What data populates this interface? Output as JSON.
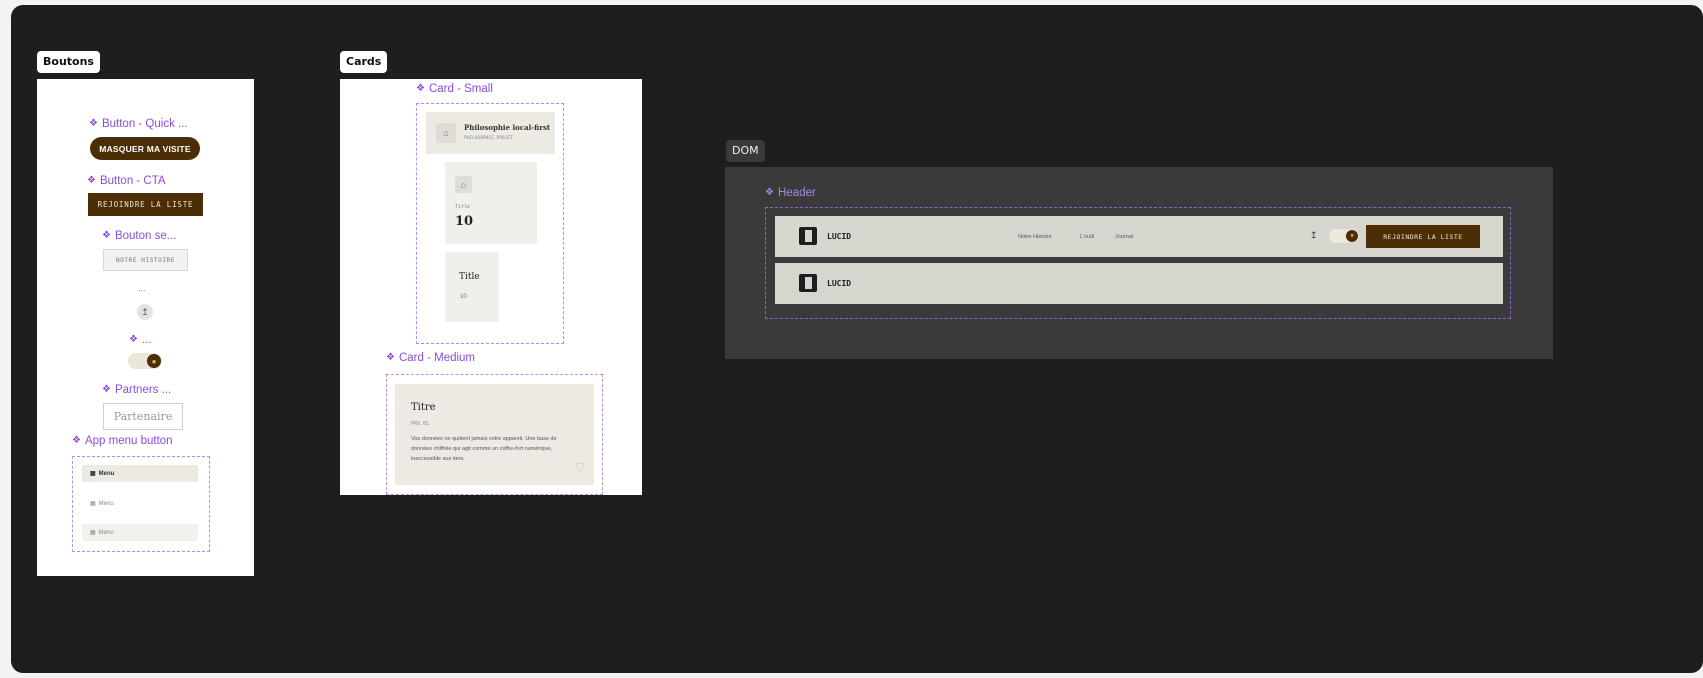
{
  "labels": {
    "boutons": "Boutons",
    "cards": "Cards",
    "dom": "DOM"
  },
  "boutons": {
    "quick_label": "Button - Quick ...",
    "quick_button": "MASQUER MA VISITE",
    "cta_label": "Button - CTA",
    "cta_button": "REJOINDRE LA LISTE",
    "secondary_label": "Bouton se...",
    "secondary_button": "NOTRE HISTOIRE",
    "ellipsis_label": "...",
    "circle_icon": "up-arrow-icon",
    "toggle_label": "...",
    "partners_label": "Partners ...",
    "partner_button": "Partenaire",
    "app_menu_label": "App menu button",
    "menu_items": [
      "Menu",
      "Menu",
      "Menu"
    ]
  },
  "cards": {
    "small_label": "Card - Small",
    "small_card_title": "Philosophie local-first",
    "small_card_meta": "PHILOSOPHIE_PROJET",
    "stat_caption": "Title",
    "stat_value": "10",
    "title_card_title": "Title",
    "title_card_value": "10",
    "medium_label": "Card - Medium",
    "medium_title": "Titre",
    "medium_meta": "PRV.01",
    "medium_body": "Vos données ne quittent jamais votre appareil. Une base de données chiffrée qui agit comme un coffre-fort numérique, inaccessible aux tiers."
  },
  "dom": {
    "header_label": "Header",
    "logo_text": "LUCID",
    "logo_text_2": "LUCID",
    "nav": [
      "Notre Histoire",
      "L'outil",
      "Journal"
    ],
    "cta": "REJOINDRE LA LISTE"
  },
  "colors": {
    "canvas": "#1e1e1e",
    "brand_brown": "#4b2e05",
    "component_purple": "#8a4ddb",
    "card_beige": "#eceae3",
    "header_bg": "#d7d6ce"
  }
}
